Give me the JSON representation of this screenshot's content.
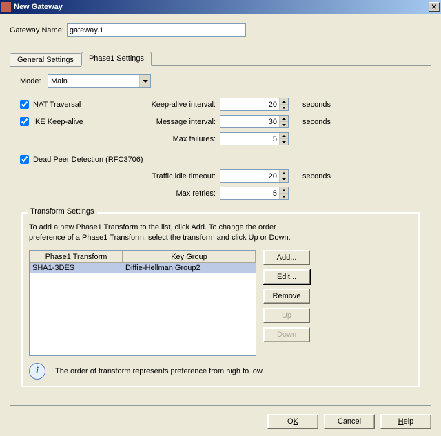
{
  "window": {
    "title": "New Gateway"
  },
  "gateway": {
    "name_label": "Gateway Name:",
    "name_value": "gateway.1"
  },
  "tabs": {
    "general": "General Settings",
    "phase1": "Phase1 Settings"
  },
  "mode": {
    "label": "Mode:",
    "value": "Main"
  },
  "nat": {
    "label": "NAT Traversal",
    "checked": true
  },
  "ike": {
    "label": "IKE Keep-alive",
    "checked": true
  },
  "keepalive": {
    "label": "Keep-alive interval:",
    "value": "20",
    "unit": "seconds"
  },
  "message": {
    "label": "Message interval:",
    "value": "30",
    "unit": "seconds"
  },
  "maxfail": {
    "label": "Max failures:",
    "value": "5"
  },
  "dpd": {
    "label": "Dead Peer Detection (RFC3706)",
    "checked": true
  },
  "idle": {
    "label": "Traffic idle timeout:",
    "value": "20",
    "unit": "seconds"
  },
  "retries": {
    "label": "Max retries:",
    "value": "5"
  },
  "group": {
    "legend": "Transform Settings",
    "instructions": "To add a new Phase1 Transform to the list, click Add. To change the order preference of a Phase1 Transform, select the transform and click Up or Down.",
    "col1": "Phase1 Transform",
    "col2": "Key Group",
    "row": {
      "transform": "SHA1-3DES",
      "keygroup": "Diffie-Hellman Group2"
    },
    "info": "The order of transform represents preference from high to low."
  },
  "buttons": {
    "add": "Add...",
    "edit": "Edit...",
    "remove": "Remove",
    "up": "Up",
    "down": "Down",
    "ok_pre": "O",
    "ok_u": "K",
    "cancel": "Cancel",
    "help_u": "H",
    "help_post": "elp"
  }
}
